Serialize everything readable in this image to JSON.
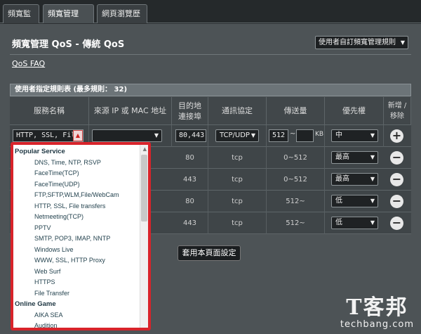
{
  "tabs": [
    "頻寬監控",
    "頻寬管理 QoS",
    "網頁瀏覽歷史"
  ],
  "page": {
    "title": "頻寬管理 QoS - 傳統 QoS",
    "mode_select": "使用者自訂頻寬管理規則",
    "faq_link": "QoS FAQ",
    "apply_button": "套用本頁面設定"
  },
  "table": {
    "caption": "使用者指定規則表 (最多規則： 32)",
    "headers": [
      "服務名稱",
      "來源 IP 或 MAC 地址",
      "目的地連接埠",
      "通訊協定",
      "傳送量",
      "優先權",
      "新增 / 移除"
    ],
    "input_row": {
      "service": "HTTP, SSL, File",
      "source": "",
      "port": "80,443,",
      "protocol": "TCP/UDP",
      "range_from": "512",
      "range_sep": "~",
      "range_to": "",
      "unit": "KB",
      "priority": "中",
      "action": "+"
    },
    "rows": [
      {
        "port": "80",
        "protocol": "tcp",
        "transfer": "0~512",
        "priority": "最高",
        "action": "−"
      },
      {
        "port": "443",
        "protocol": "tcp",
        "transfer": "0~512",
        "priority": "最高",
        "action": "−"
      },
      {
        "port": "80",
        "protocol": "tcp",
        "transfer": "512~",
        "priority": "低",
        "action": "−"
      },
      {
        "port": "443",
        "protocol": "tcp",
        "transfer": "512~",
        "priority": "低",
        "action": "−"
      }
    ]
  },
  "dropdown": {
    "items": [
      {
        "label": "Popular Service",
        "group": true
      },
      {
        "label": "DNS, Time, NTP, RSVP",
        "group": false
      },
      {
        "label": "FaceTime(TCP)",
        "group": false
      },
      {
        "label": "FaceTime(UDP)",
        "group": false
      },
      {
        "label": "FTP,SFTP,WLM,File/WebCam",
        "group": false
      },
      {
        "label": "HTTP, SSL, File transfers",
        "group": false
      },
      {
        "label": "Netmeeting(TCP)",
        "group": false
      },
      {
        "label": "PPTV",
        "group": false
      },
      {
        "label": "SMTP, POP3, IMAP, NNTP",
        "group": false
      },
      {
        "label": "Windows Live",
        "group": false
      },
      {
        "label": "WWW, SSL, HTTP Proxy",
        "group": false
      },
      {
        "label": "Web Surf",
        "group": false
      },
      {
        "label": "HTTPS",
        "group": false
      },
      {
        "label": "File Transfer",
        "group": false
      },
      {
        "label": "Online Game",
        "group": true
      },
      {
        "label": "AIKA SEA",
        "group": false
      },
      {
        "label": "Audition",
        "group": false
      }
    ]
  },
  "watermark": {
    "big": "T客邦",
    "small": "techbang.com"
  },
  "icons": {
    "dropdown_arrow": "chevron-down-icon",
    "add": "plus-circle-icon",
    "remove": "minus-circle-icon"
  },
  "colors": {
    "highlight": "#d8232a",
    "panel": "#4d5356"
  }
}
